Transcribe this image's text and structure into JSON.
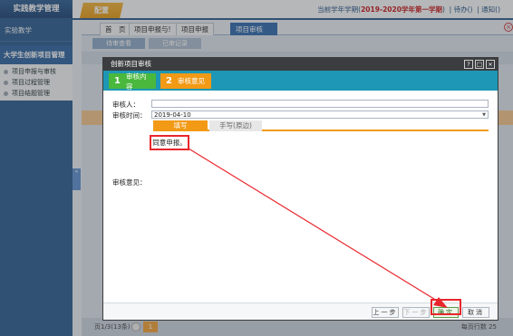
{
  "app": {
    "title": "实践教学管理",
    "config_tab": "配置"
  },
  "header_links": {
    "semester_prefix": "当前学年学期(",
    "semester": "2019-2020学年第一学期",
    "semester_suffix": ")",
    "todo": "待办()",
    "notice": "通知()"
  },
  "sidebar": {
    "section": "实验教学",
    "group": "大学生创新项目管理",
    "items": [
      {
        "label": "项目申报与审核"
      },
      {
        "label": "项目过程管理"
      },
      {
        "label": "项目结题管理"
      }
    ],
    "toggle": "«"
  },
  "tabs": [
    {
      "label": "首　页"
    },
    {
      "label": "项目申报与!"
    },
    {
      "label": "项目申报"
    },
    {
      "label": "项目审核",
      "active": true
    }
  ],
  "tab_close": "×",
  "subtabs": [
    {
      "label": "待审查看"
    },
    {
      "label": "已审记录"
    }
  ],
  "background": {
    "footer_left": "页1/3(13条)",
    "page": "1",
    "footer_right": "每页行数 25"
  },
  "dialog": {
    "title": "创新项目审核",
    "window_buttons": [
      "?",
      "□",
      "×"
    ],
    "steps": [
      {
        "num": "1",
        "label": "审核内容"
      },
      {
        "num": "2",
        "label": "审核意见"
      }
    ],
    "reviewer_label": "审核人：",
    "reviewer_value": "",
    "time_label": "审核时间：",
    "time_value": "2019-04-10",
    "write_tabs": [
      {
        "label": "填写"
      },
      {
        "label": "手写(原边)"
      }
    ],
    "opinion_text": "同意申报。",
    "opinion_label": "审核意见：",
    "buttons": {
      "prev": "上一步",
      "next": "下一步",
      "confirm": "确定",
      "cancel": "取消"
    }
  },
  "colors": {
    "primary": "#2a5b93",
    "accent": "#f29a16",
    "step_done": "#49b83c",
    "highlight": "#e8262c"
  }
}
